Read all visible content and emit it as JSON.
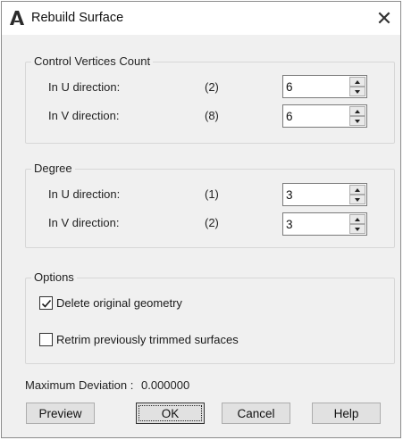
{
  "window": {
    "title": "Rebuild Surface",
    "close_glyph": "✕",
    "app_icon": "autocad-a-icon"
  },
  "control_vertices": {
    "group_title": "Control Vertices Count",
    "u_label": "In U direction:",
    "u_current": "(2)",
    "u_value": "6",
    "v_label": "In V direction:",
    "v_current": "(8)",
    "v_value": "6"
  },
  "degree": {
    "group_title": "Degree",
    "u_label": "In U direction:",
    "u_current": "(1)",
    "u_value": "3",
    "v_label": "In V direction:",
    "v_current": "(2)",
    "v_value": "3"
  },
  "options": {
    "group_title": "Options",
    "delete_original_label": "Delete original geometry",
    "delete_original_checked": true,
    "retrim_label": "Retrim previously trimmed surfaces",
    "retrim_checked": false
  },
  "deviation": {
    "label": "Maximum Deviation :",
    "value": "0.000000"
  },
  "buttons": {
    "preview": "Preview",
    "ok": "OK",
    "cancel": "Cancel",
    "help": "Help"
  }
}
